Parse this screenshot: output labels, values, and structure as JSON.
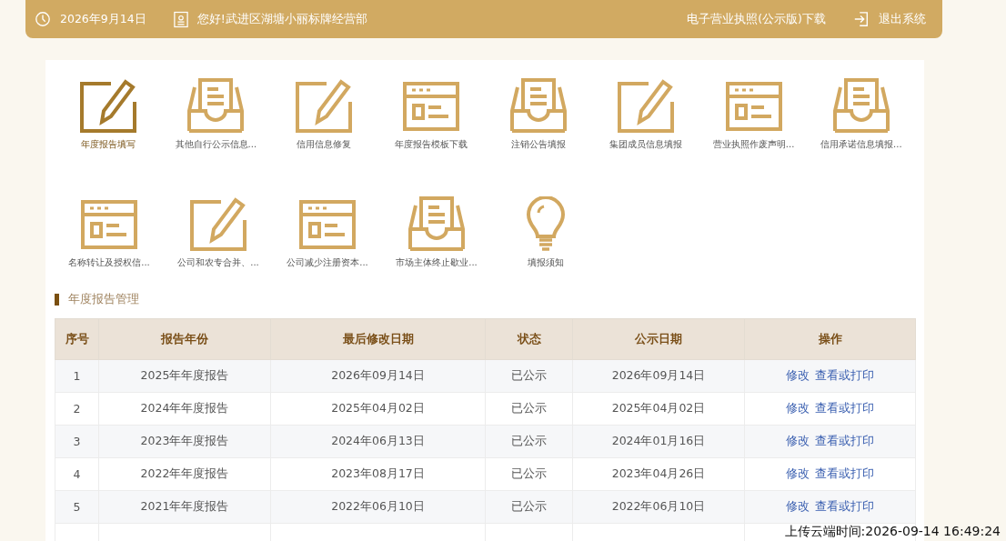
{
  "header": {
    "date": "2026年9月14日",
    "greeting": "您好!武进区湖塘小丽标牌经营部",
    "license_link": "电子营业执照(公示版)下载",
    "logout": "退出系统"
  },
  "shortcuts": [
    {
      "kind": "pencil",
      "label": "年度报告填写",
      "selected": true
    },
    {
      "kind": "tray",
      "label": "其他自行公示信息...",
      "selected": false
    },
    {
      "kind": "pencil",
      "label": "信用信息修复",
      "selected": false
    },
    {
      "kind": "form",
      "label": "年度报告模板下载",
      "selected": false
    },
    {
      "kind": "tray",
      "label": "注销公告填报",
      "selected": false
    },
    {
      "kind": "pencil",
      "label": "集团成员信息填报",
      "selected": false
    },
    {
      "kind": "form",
      "label": "营业执照作废声明...",
      "selected": false
    },
    {
      "kind": "tray",
      "label": "信用承诺信息填报...",
      "selected": false
    },
    {
      "kind": "form",
      "label": "名称转让及授权信...",
      "selected": false
    },
    {
      "kind": "pencil",
      "label": "公司和农专合并、...",
      "selected": false
    },
    {
      "kind": "form",
      "label": "公司减少注册资本...",
      "selected": false
    },
    {
      "kind": "tray",
      "label": "市场主体终止歇业...",
      "selected": false
    },
    {
      "kind": "bulb",
      "label": "填报须知",
      "selected": false
    }
  ],
  "section_title": "年度报告管理",
  "table": {
    "columns": [
      "序号",
      "报告年份",
      "最后修改日期",
      "状态",
      "公示日期",
      "操作"
    ],
    "rows": [
      {
        "index": "1",
        "year": "2025年年度报告",
        "modified": "2026年09月14日",
        "status": "已公示",
        "published": "2026年09月14日",
        "actions": [
          "修改",
          "查看或打印"
        ]
      },
      {
        "index": "2",
        "year": "2024年年度报告",
        "modified": "2025年04月02日",
        "status": "已公示",
        "published": "2025年04月02日",
        "actions": [
          "修改",
          "查看或打印"
        ]
      },
      {
        "index": "3",
        "year": "2023年年度报告",
        "modified": "2024年06月13日",
        "status": "已公示",
        "published": "2024年01月16日",
        "actions": [
          "修改",
          "查看或打印"
        ]
      },
      {
        "index": "4",
        "year": "2022年年度报告",
        "modified": "2023年08月17日",
        "status": "已公示",
        "published": "2023年04月26日",
        "actions": [
          "修改",
          "查看或打印"
        ]
      },
      {
        "index": "5",
        "year": "2021年年度报告",
        "modified": "2022年06月10日",
        "status": "已公示",
        "published": "2022年06月10日",
        "actions": [
          "修改",
          "查看或打印"
        ]
      }
    ]
  },
  "upload_stamp": "上传云端时间:2026-09-14 16:49:24"
}
